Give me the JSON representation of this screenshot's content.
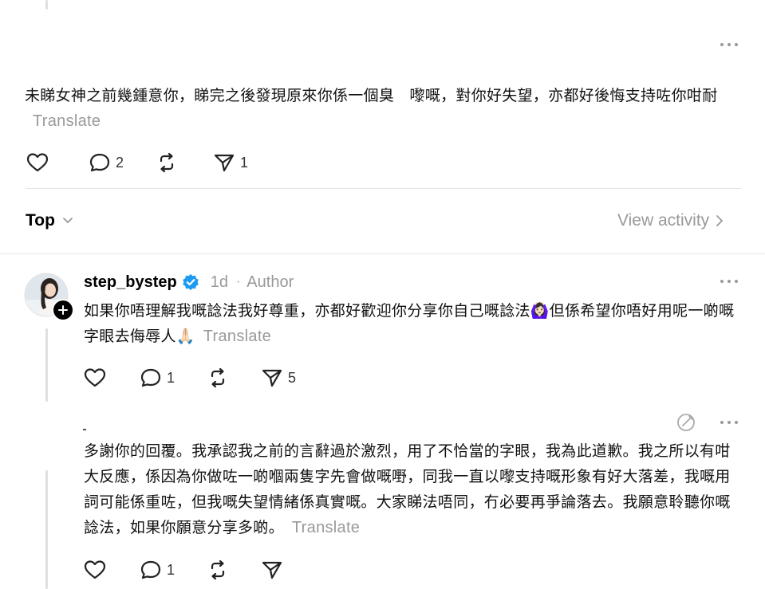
{
  "top_post": {
    "text": "未睇女神之前幾鍾意你，睇完之後發現原來你係一個臭　嚟嘅，對你好失望，亦都好後悔支持咗你咁耐",
    "translate_label": "Translate",
    "reply_count": "2",
    "share_count": "1"
  },
  "sort": {
    "label": "Top",
    "view_activity": "View activity"
  },
  "reply1": {
    "username": "step_bystep",
    "time": "1d",
    "separator": "·",
    "author_badge": "Author",
    "text": "如果你唔理解我嘅諗法我好尊重，亦都好歡迎你分享你自己嘅諗法🙆🏻‍♀️但係希望你唔好用呢一啲嘅字眼去侮辱人🙏🏻",
    "translate_label": "Translate",
    "reply_count": "1",
    "share_count": "5",
    "verified_color": "#1d9bf0"
  },
  "reply2": {
    "text": "多謝你的回覆。我承認我之前的言辭過於激烈，用了不恰當的字眼，我為此道歉。我之所以有咁大反應，係因為你做咗一啲嗰兩隻字先會做嘅嘢，同我一直以嚟支持嘅形象有好大落差，我嘅用詞可能係重咗，但我嘅失望情緒係真實嘅。大家睇法唔同，冇必要再爭論落去。我願意聆聽你嘅諗法，如果你願意分享多啲。",
    "translate_label": "Translate",
    "reply_count": "1"
  }
}
